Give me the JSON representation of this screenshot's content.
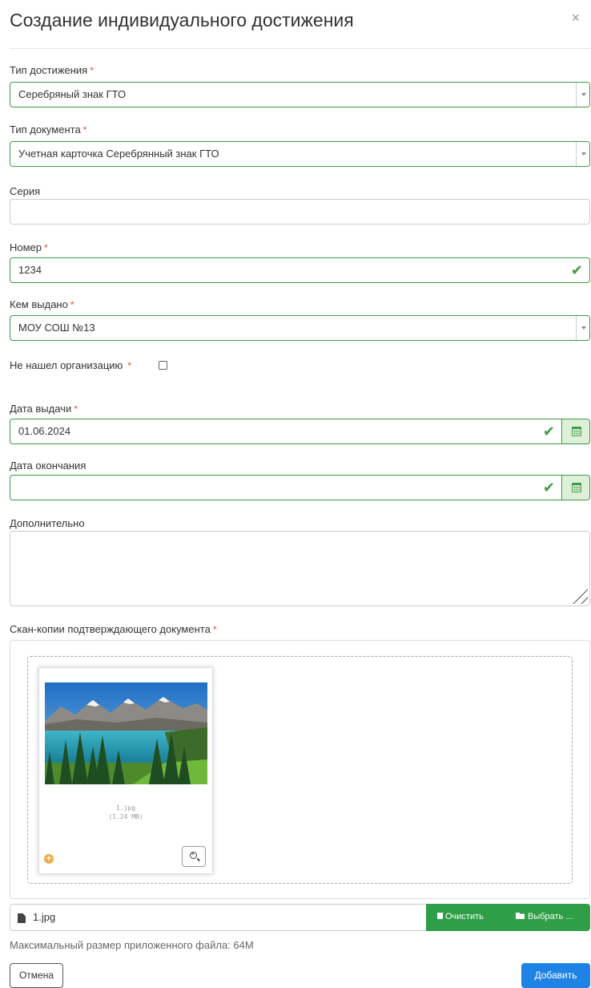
{
  "modal": {
    "title": "Создание индивидуального достижения",
    "close": "×"
  },
  "fields": {
    "achievement_type": {
      "label": "Тип достижения",
      "value": "Серебряный знак ГТО"
    },
    "document_type": {
      "label": "Тип документа",
      "value": "Учетная карточка Серебрянный знак ГТО"
    },
    "series": {
      "label": "Серия",
      "value": ""
    },
    "number": {
      "label": "Номер",
      "value": "1234"
    },
    "issued_by": {
      "label": "Кем выдано",
      "value": "МОУ СОШ №13"
    },
    "org_not_found": {
      "label": "Не нашел организацию"
    },
    "issue_date": {
      "label": "Дата выдачи",
      "value": "01.06.2024"
    },
    "end_date": {
      "label": "Дата окончания",
      "value": ""
    },
    "additional": {
      "label": "Дополнительно",
      "value": ""
    },
    "scans": {
      "label": "Скан-копии подтверждающего документа"
    }
  },
  "required_mark": "*",
  "upload": {
    "file_name": "1.jpg",
    "file_size": "(1.24 MB)",
    "input_file_name": "1.jpg",
    "clear_label": "Очистить",
    "browse_label": "Выбрать ...",
    "hint": "Максимальный размер приложенного файла: 64M"
  },
  "actions": {
    "cancel": "Отмена",
    "add": "Добавить"
  },
  "colors": {
    "valid": "#3c9c48",
    "primary": "#1f83e6",
    "success_btn": "#2f9e46",
    "required": "#e74c3c"
  }
}
